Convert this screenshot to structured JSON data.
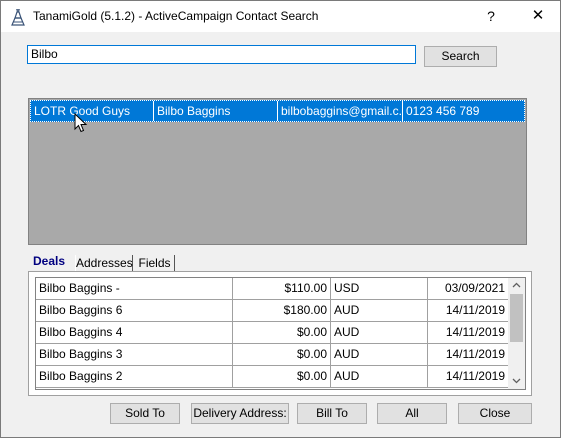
{
  "window": {
    "title": "TanamiGold (5.1.2) - ActiveCampaign Contact Search",
    "help_label": "?",
    "close_label": "✕"
  },
  "search": {
    "value": "Bilbo",
    "button_label": "Search"
  },
  "results": {
    "rows": [
      {
        "list": "LOTR Good Guys",
        "name": "Bilbo Baggins",
        "email": "bilbobaggins@gmail.c...",
        "phone": "0123 456 789",
        "selected": true
      }
    ]
  },
  "tabs": [
    {
      "label": "Deals",
      "active": true
    },
    {
      "label": "Addresses",
      "active": false
    },
    {
      "label": "Fields",
      "active": false
    }
  ],
  "deals": {
    "rows": [
      {
        "title": "Bilbo Baggins -",
        "amount": "$110.00",
        "currency": "USD",
        "date": "03/09/2021"
      },
      {
        "title": "Bilbo Baggins 6",
        "amount": "$180.00",
        "currency": "AUD",
        "date": "14/11/2019"
      },
      {
        "title": "Bilbo Baggins 4",
        "amount": "$0.00",
        "currency": "AUD",
        "date": "14/11/2019"
      },
      {
        "title": "Bilbo Baggins 3",
        "amount": "$0.00",
        "currency": "AUD",
        "date": "14/11/2019"
      },
      {
        "title": "Bilbo Baggins 2",
        "amount": "$0.00",
        "currency": "AUD",
        "date": "14/11/2019"
      }
    ]
  },
  "buttons": {
    "sold_to": "Sold To",
    "delivery_address": "Delivery Address:",
    "bill_to": "Bill To",
    "all": "All",
    "close": "Close"
  },
  "icons": {
    "app": "tower-icon",
    "cursor": "mouse-pointer-icon",
    "scroll_up": "chevron-up-icon",
    "scroll_down": "chevron-down-icon"
  },
  "colors": {
    "selection": "#0078d7",
    "results_bg": "#a9a9a9",
    "active_tab": "#000080",
    "input_focus": "#0078d7"
  }
}
